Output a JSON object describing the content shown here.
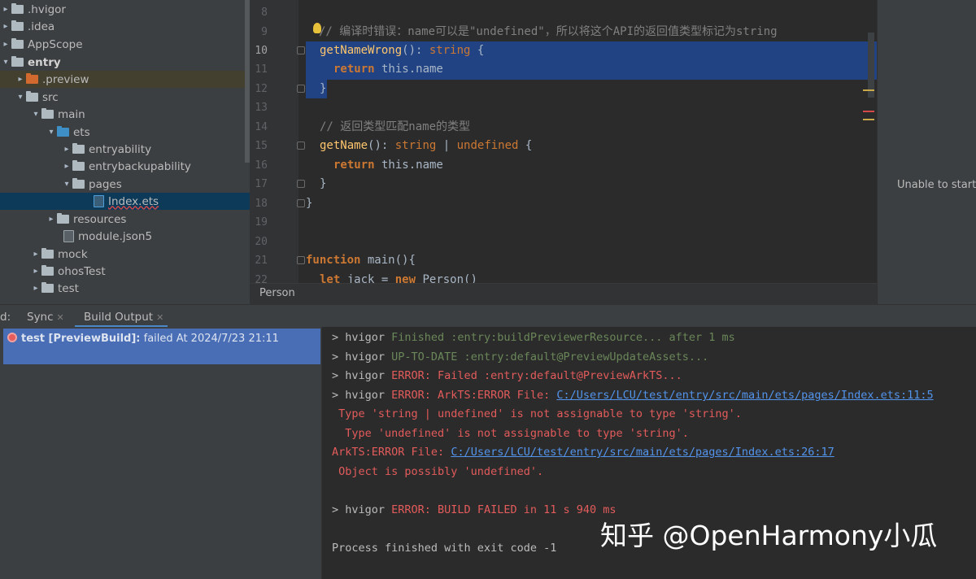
{
  "project_tree": {
    "items": [
      {
        "label": ".hvigor",
        "icon": "folder-icon",
        "expanded": false
      },
      {
        "label": ".idea",
        "icon": "folder-icon",
        "expanded": false
      },
      {
        "label": "AppScope",
        "icon": "folder-icon",
        "expanded": false
      },
      {
        "label": "entry",
        "icon": "folder-icon",
        "expanded": true
      },
      {
        "label": ".preview",
        "icon": "folder-icon",
        "expanded": false
      },
      {
        "label": "src",
        "icon": "folder-icon",
        "expanded": true
      },
      {
        "label": "main",
        "icon": "folder-icon",
        "expanded": true
      },
      {
        "label": "ets",
        "icon": "folder-icon",
        "expanded": true
      },
      {
        "label": "entryability",
        "icon": "folder-icon",
        "expanded": false
      },
      {
        "label": "entrybackupability",
        "icon": "folder-icon",
        "expanded": false
      },
      {
        "label": "pages",
        "icon": "folder-icon",
        "expanded": true
      },
      {
        "label": "Index.ets",
        "icon": "file-icon",
        "selected": true
      },
      {
        "label": "resources",
        "icon": "folder-icon",
        "expanded": false
      },
      {
        "label": "module.json5",
        "icon": "file-icon"
      },
      {
        "label": "mock",
        "icon": "folder-icon",
        "expanded": false
      },
      {
        "label": "ohosTest",
        "icon": "folder-icon",
        "expanded": false
      },
      {
        "label": "test",
        "icon": "folder-icon",
        "expanded": false
      }
    ]
  },
  "editor": {
    "current_line": "10",
    "lines": [
      {
        "n": "8"
      },
      {
        "n": "9",
        "comment": "// 编译时错误：name可以是\"undefined\"，所以将这个API的返回值类型标记为string"
      },
      {
        "n": "10",
        "name": "getNameWrong",
        "punct": "(): ",
        "type": "string",
        "tail": " {"
      },
      {
        "n": "11",
        "kw": "return",
        "expr": " this.name"
      },
      {
        "n": "12",
        "brace": "}"
      },
      {
        "n": "13"
      },
      {
        "n": "14",
        "comment": "// 返回类型匹配name的类型"
      },
      {
        "n": "15",
        "name": "getName",
        "punct": "(): ",
        "type": "string",
        "pipe": " | ",
        "type2": "undefined",
        "tail": " {"
      },
      {
        "n": "16",
        "kw": "return",
        "expr": " this.name"
      },
      {
        "n": "17",
        "brace": "}"
      },
      {
        "n": "18",
        "brace": "}"
      },
      {
        "n": "19"
      },
      {
        "n": "20"
      },
      {
        "n": "21",
        "kw": "function",
        "name": " main",
        "tail": "(){"
      },
      {
        "n": "22",
        "kw": "let",
        "expr": " jack = ",
        "kw2": "new",
        "cls": " Person()"
      }
    ],
    "breadcrumb": "Person"
  },
  "preview": {
    "message": "Unable to start"
  },
  "build_window": {
    "tabs": [
      {
        "label": "d:"
      },
      {
        "label": "Sync"
      },
      {
        "label": "Build Output",
        "active": true
      }
    ],
    "task": {
      "name": "test [PreviewBuild]:",
      "status": " failed At 2024/7/23 21:11"
    },
    "console": [
      {
        "parts": [
          {
            "t": "> hvigor ",
            "c": "plain"
          },
          {
            "t": "Finished :entry:buildPreviewerResource... after 1 ms",
            "c": "green"
          }
        ]
      },
      {
        "parts": [
          {
            "t": "> hvigor ",
            "c": "plain"
          },
          {
            "t": "UP-TO-DATE :entry:default@PreviewUpdateAssets...",
            "c": "green"
          }
        ]
      },
      {
        "parts": [
          {
            "t": "> hvigor ",
            "c": "plain"
          },
          {
            "t": "ERROR: Failed :entry:default@PreviewArkTS...",
            "c": "red"
          }
        ]
      },
      {
        "parts": [
          {
            "t": "> hvigor ",
            "c": "plain"
          },
          {
            "t": "ERROR: ArkTS:ERROR File: ",
            "c": "red"
          },
          {
            "t": "C:/Users/LCU/test/entry/src/main/ets/pages/Index.ets:11:5",
            "c": "link"
          }
        ]
      },
      {
        "parts": [
          {
            "t": " Type 'string | undefined' is not assignable to type 'string'.",
            "c": "red"
          }
        ]
      },
      {
        "parts": [
          {
            "t": "  Type 'undefined' is not assignable to type 'string'.",
            "c": "red"
          }
        ]
      },
      {
        "parts": [
          {
            "t": "ArkTS:ERROR File: ",
            "c": "red"
          },
          {
            "t": "C:/Users/LCU/test/entry/src/main/ets/pages/Index.ets:26:17",
            "c": "link"
          }
        ]
      },
      {
        "parts": [
          {
            "t": " Object is possibly 'undefined'.",
            "c": "red"
          }
        ]
      },
      {
        "parts": []
      },
      {
        "parts": [
          {
            "t": "> hvigor ",
            "c": "plain"
          },
          {
            "t": "ERROR: BUILD FAILED in 11 s 940 ms",
            "c": "red"
          }
        ]
      },
      {
        "parts": []
      },
      {
        "parts": [
          {
            "t": "Process finished with exit code -1",
            "c": "plain"
          }
        ]
      }
    ]
  },
  "watermark": "知乎 @OpenHarmony小瓜"
}
